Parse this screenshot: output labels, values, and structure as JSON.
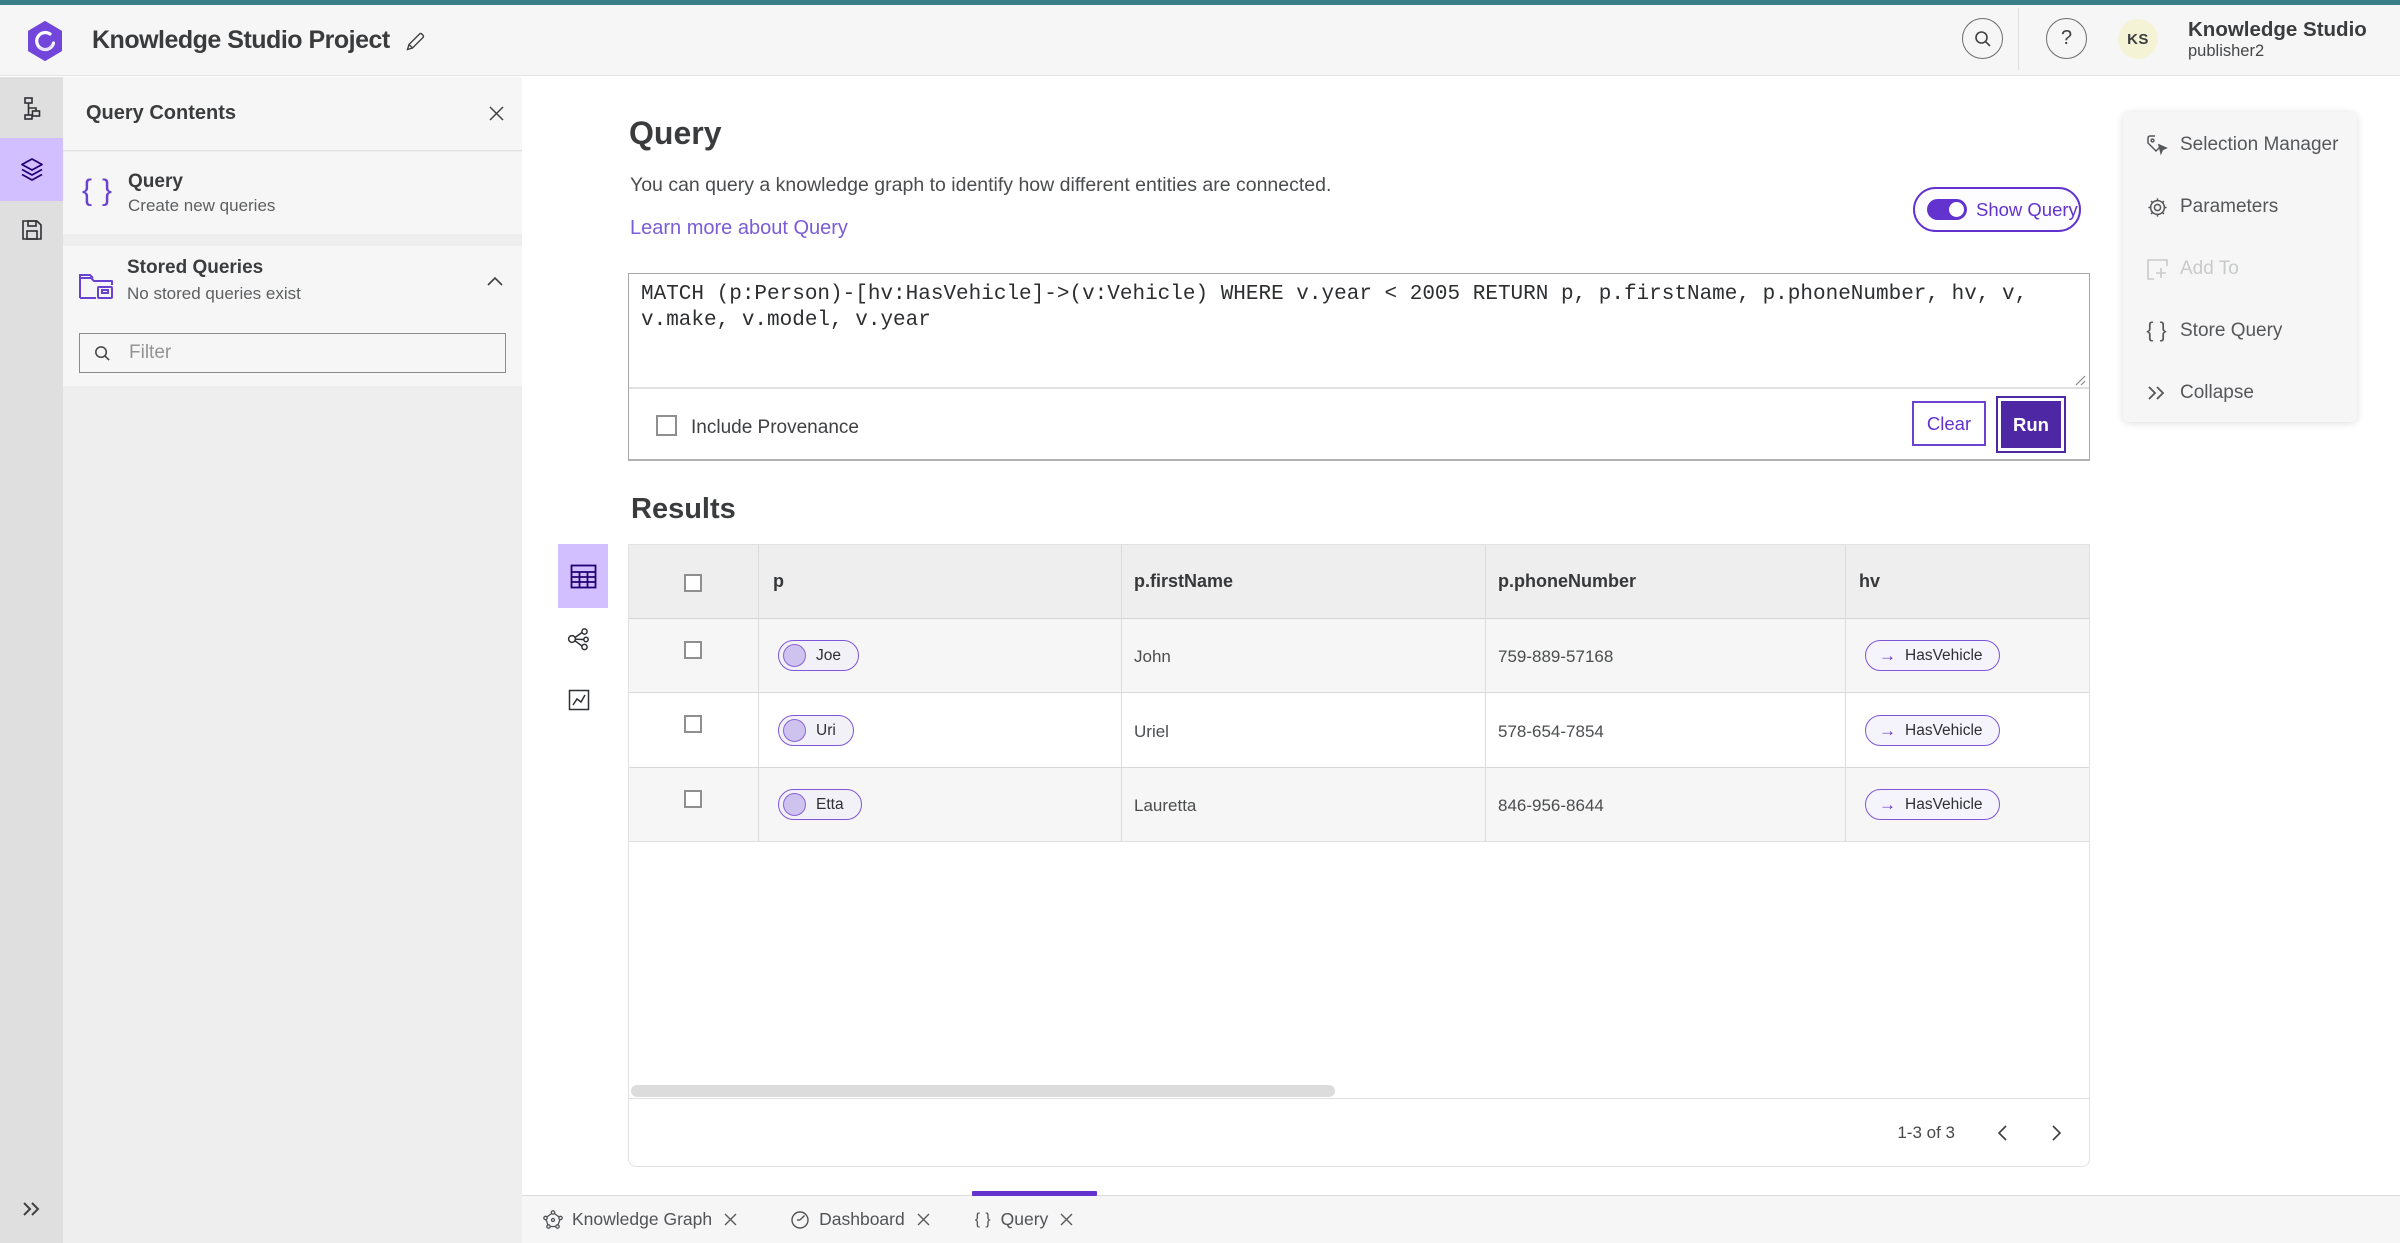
{
  "topbar": {
    "project_title": "Knowledge Studio Project",
    "account_name": "Knowledge Studio",
    "account_role": "publisher2",
    "avatar_initials": "KS"
  },
  "side_panel": {
    "title": "Query Contents",
    "query_item": {
      "title": "Query",
      "subtitle": "Create new queries"
    },
    "stored_item": {
      "title": "Stored Queries",
      "subtitle": "No stored queries exist"
    },
    "filter_placeholder": "Filter"
  },
  "query_section": {
    "title": "Query",
    "description": "You can query a knowledge graph to identify how different entities are connected.",
    "learn_more": "Learn more about Query",
    "show_query_label": "Show Query",
    "query_text": "MATCH (p:Person)-[hv:HasVehicle]->(v:Vehicle) WHERE v.year < 2005 RETURN p, p.firstName, p.phoneNumber, hv, v,\nv.make, v.model, v.year",
    "include_provenance_label": "Include Provenance",
    "clear_label": "Clear",
    "run_label": "Run"
  },
  "results": {
    "title": "Results",
    "columns": [
      "p",
      "p.firstName",
      "p.phoneNumber",
      "hv"
    ],
    "rows": [
      {
        "p": "Joe",
        "firstName": "John",
        "phoneNumber": "759-889-57168",
        "hv": "HasVehicle"
      },
      {
        "p": "Uri",
        "firstName": "Uriel",
        "phoneNumber": "578-654-7854",
        "hv": "HasVehicle"
      },
      {
        "p": "Etta",
        "firstName": "Lauretta",
        "phoneNumber": "846-956-8644",
        "hv": "HasVehicle"
      }
    ],
    "pagination": "1-3 of 3"
  },
  "actions_panel": {
    "items": [
      {
        "label": "Selection Manager"
      },
      {
        "label": "Parameters"
      },
      {
        "label": "Add To"
      },
      {
        "label": "Store Query"
      },
      {
        "label": "Collapse"
      }
    ]
  },
  "tabs": [
    {
      "label": "Knowledge Graph"
    },
    {
      "label": "Dashboard"
    },
    {
      "label": "Query"
    }
  ],
  "colors": {
    "accent": "#6233ce",
    "accent_dark": "#4e27a5",
    "logo": "#7245db",
    "rail_highlight": "#d2bfff",
    "teal": "#387f87"
  }
}
